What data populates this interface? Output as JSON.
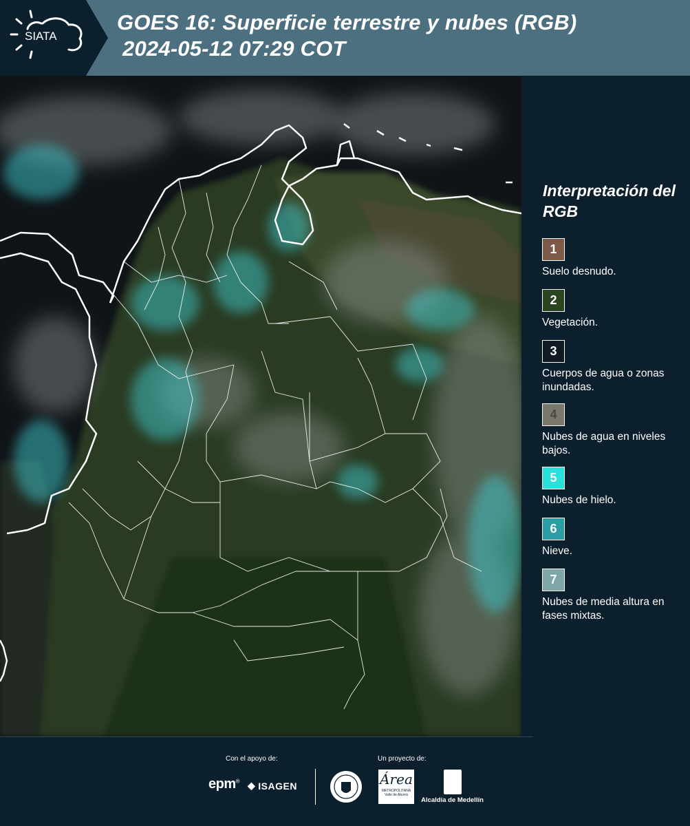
{
  "header": {
    "logo_text": "SIATA",
    "title_line1": "GOES 16: Superficie terrestre y nubes (RGB)",
    "title_line2": "2024-05-12 07:29 COT"
  },
  "legend": {
    "title": "Interpretación del RGB",
    "items": [
      {
        "number": "1",
        "label": "Suelo desnudo.",
        "color": "#7d5947"
      },
      {
        "number": "2",
        "label": "Vegetación.",
        "color": "#2b4520"
      },
      {
        "number": "3",
        "label": "Cuerpos de agua o zonas inundadas.",
        "color": "#0f1a24"
      },
      {
        "number": "4",
        "label": "Nubes de agua en niveles bajos.",
        "color": "#7a776d"
      },
      {
        "number": "5",
        "label": "Nubes de hielo.",
        "color": "#2ae0dd"
      },
      {
        "number": "6",
        "label": "Nieve.",
        "color": "#2a9ea4"
      },
      {
        "number": "7",
        "label": "Nubes de media altura en fases mixtas.",
        "color": "#7fa7aa"
      }
    ]
  },
  "footer": {
    "support_label": "Con el apoyo de:",
    "project_label": "Un proyecto de:",
    "epm_logo": "epm",
    "isagen_logo": "ISAGEN",
    "area_logo": "Área",
    "area_logo_sub": "METROPOLITANA Valle de Aburrá",
    "alcaldia_logo": "Alcaldía de Medellín"
  }
}
